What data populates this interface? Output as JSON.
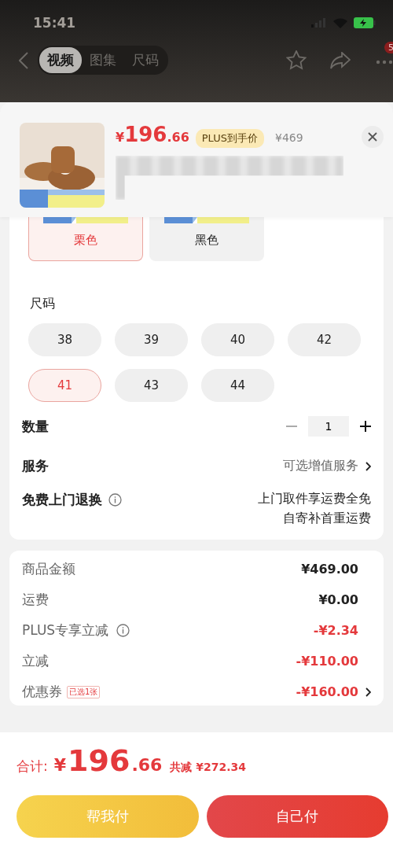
{
  "status_bar": {
    "time": "15:41"
  },
  "nav": {
    "tabs": [
      {
        "label": "视频",
        "selected": true
      },
      {
        "label": "图集",
        "selected": false
      },
      {
        "label": "尺码",
        "selected": false
      }
    ],
    "badge": "5"
  },
  "product": {
    "price_symbol": "¥",
    "price_int": "196",
    "price_dec": ".66",
    "price_tag": "PLUS到手价",
    "original_price": "¥469"
  },
  "colors": [
    {
      "label": "栗色",
      "selected": true
    },
    {
      "label": "黑色",
      "selected": false
    }
  ],
  "size_section": {
    "title": "尺码",
    "sizes": [
      {
        "label": "38",
        "selected": false
      },
      {
        "label": "39",
        "selected": false
      },
      {
        "label": "40",
        "selected": false
      },
      {
        "label": "42",
        "selected": false
      },
      {
        "label": "41",
        "selected": true
      },
      {
        "label": "43",
        "selected": false
      },
      {
        "label": "44",
        "selected": false
      }
    ]
  },
  "quantity": {
    "label": "数量",
    "value": "1"
  },
  "service": {
    "label": "服务",
    "value": "可选增值服务"
  },
  "free_return": {
    "label": "免费上门退换",
    "lines": [
      "上门取件享运费全免",
      "自寄补首重运费"
    ]
  },
  "summary": [
    {
      "label": "商品金额",
      "value": "¥469.00",
      "kind": "plain"
    },
    {
      "label": "运费",
      "value": "¥0.00",
      "kind": "plain"
    },
    {
      "label": "PLUS专享立减",
      "value": "-¥2.34",
      "kind": "discount",
      "info": true
    },
    {
      "label": "立减",
      "value": "-¥110.00",
      "kind": "discount"
    },
    {
      "label": "优惠券",
      "value": "-¥160.00",
      "kind": "discount",
      "tag": "已选1张",
      "chevron": true
    }
  ],
  "total": {
    "label": "合计:",
    "symbol": "¥",
    "int": "196",
    "dec": ".66",
    "saved": "共减 ¥272.34"
  },
  "buttons": [
    {
      "label": "帮我付",
      "kind": "friend"
    },
    {
      "label": "自己付",
      "kind": "self"
    }
  ]
}
